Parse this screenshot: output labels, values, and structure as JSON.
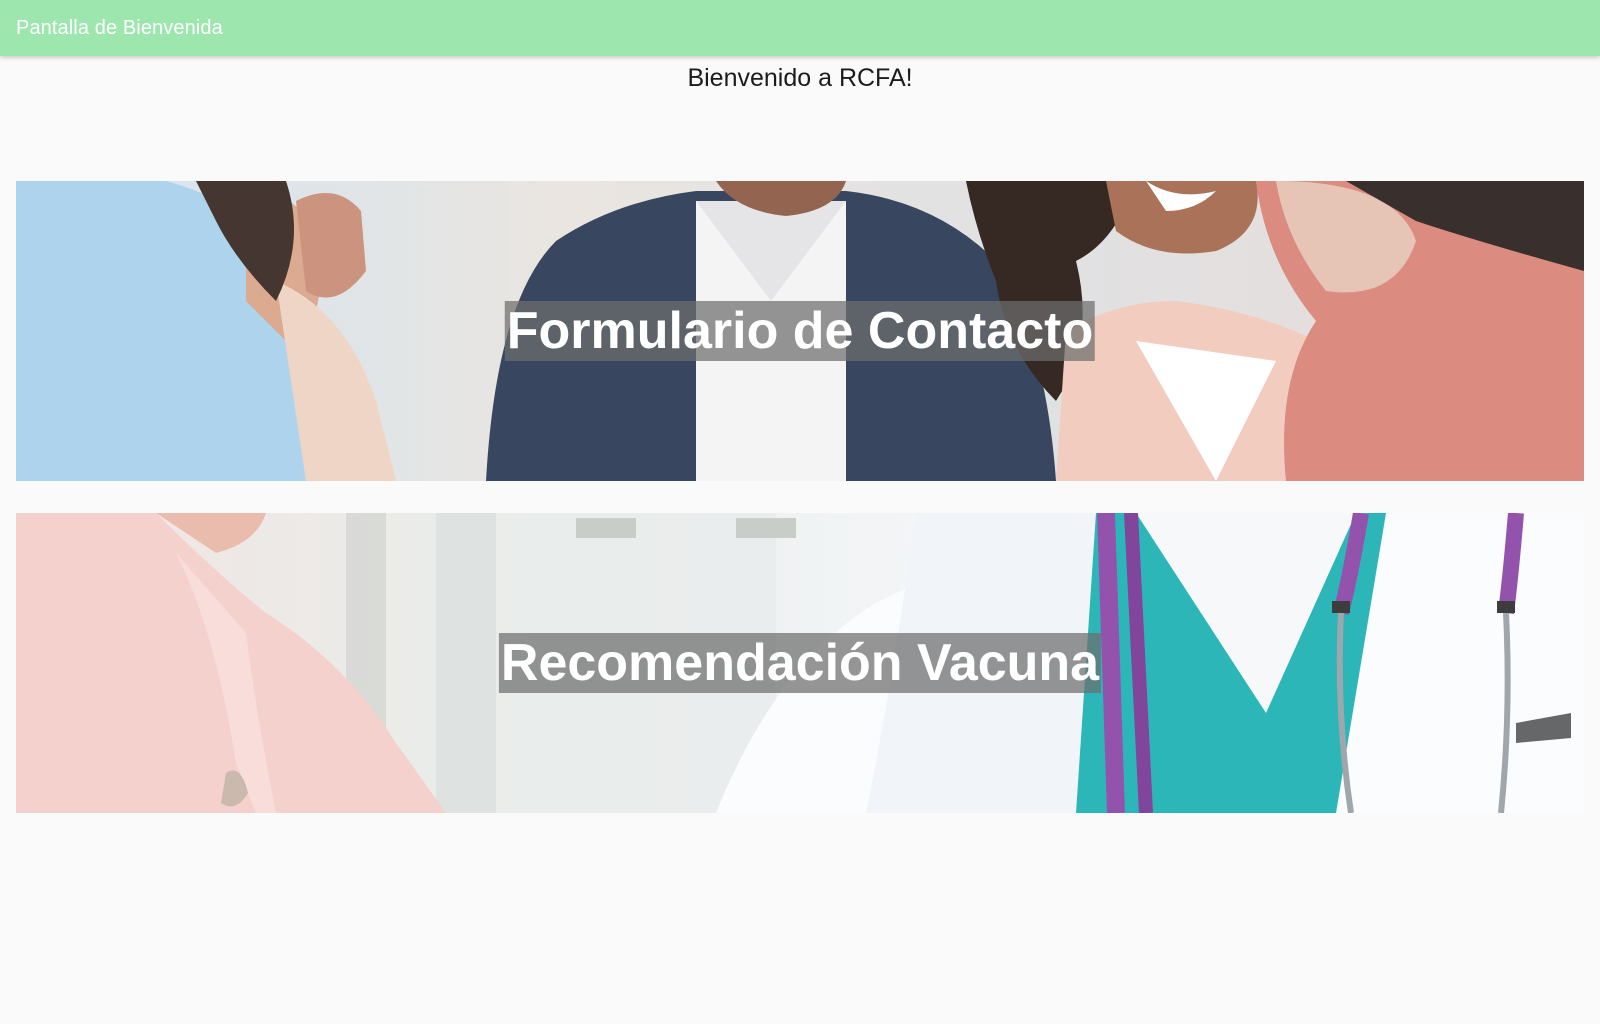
{
  "app_bar": {
    "title": "Pantalla de Bienvenida",
    "color": "#9de6ad"
  },
  "welcome": {
    "text": "Bienvenido a RCFA!"
  },
  "cards": [
    {
      "label": "Formulario de Contacto",
      "image": "group-of-smiling-people-photo"
    },
    {
      "label": "Recomendación Vacuna",
      "image": "doctor-with-stethoscope-and-patient-photo"
    }
  ]
}
